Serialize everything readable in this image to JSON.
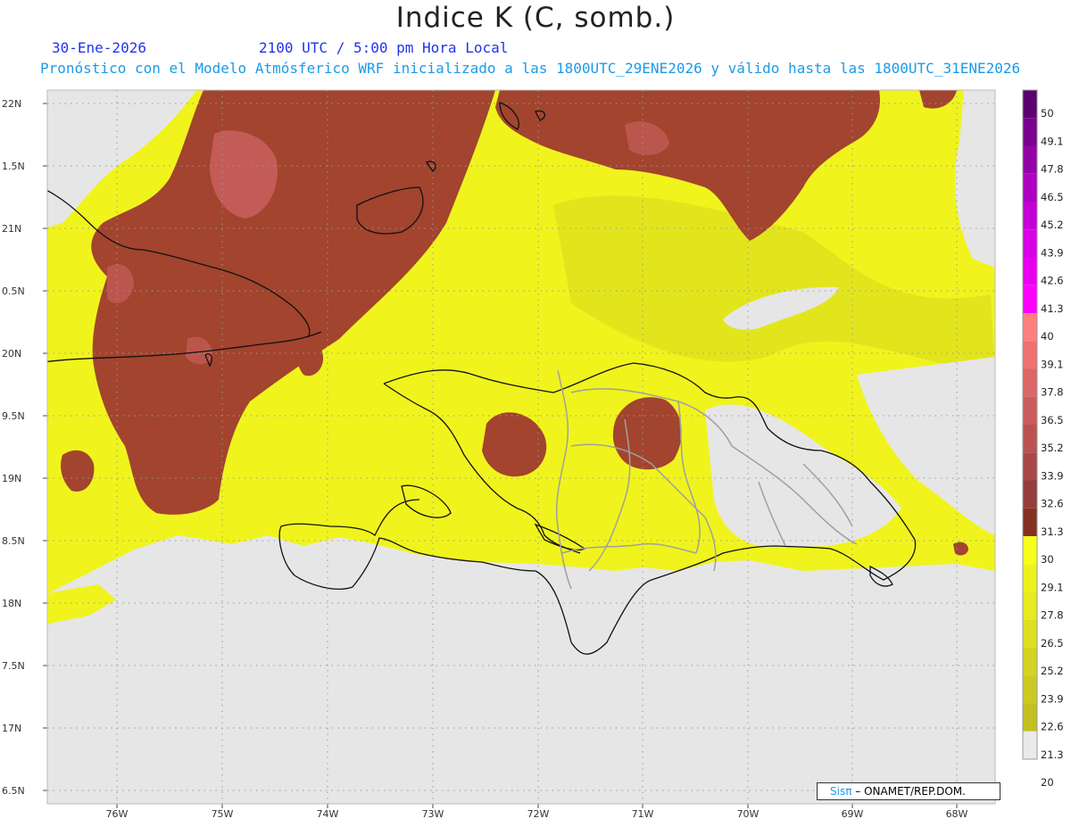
{
  "title": "Indice K (C, somb.)",
  "date": "30-Ene-2026",
  "time": "2100 UTC / 5:00 pm Hora Local",
  "info": "Pronóstico con el Modelo Atmósferico WRF inicializado a las 1800UTC_29ENE2026 y válido hasta las  1800UTC_31ENE2026",
  "lat_labels": [
    "22N",
    "1.5N",
    "21N",
    "0.5N",
    "20N",
    "9.5N",
    "19N",
    "8.5N",
    "18N",
    "7.5N",
    "17N",
    "6.5N"
  ],
  "lon_labels": [
    "76W",
    "75W",
    "74W",
    "73W",
    "72W",
    "71W",
    "70W",
    "69W",
    "68W"
  ],
  "colorbar": {
    "levels": [
      "50",
      "49.1",
      "47.8",
      "46.5",
      "45.2",
      "43.9",
      "42.6",
      "41.3",
      "40",
      "39.1",
      "37.8",
      "36.5",
      "35.2",
      "33.9",
      "32.6",
      "31.3",
      "30",
      "29.1",
      "27.8",
      "26.5",
      "25.2",
      "23.9",
      "22.6",
      "21.3",
      "20"
    ],
    "colors": [
      "#5c0070",
      "#7a0090",
      "#9400a8",
      "#ad00c0",
      "#c400d6",
      "#d800e4",
      "#ea00ee",
      "#ff00ff",
      "#ff8080",
      "#ee7070",
      "#dd6666",
      "#cc5c5c",
      "#bb5252",
      "#a84848",
      "#963c3c",
      "#843022",
      "#f5ff1a",
      "#eef21c",
      "#e6ea1e",
      "#dde020",
      "#d4d422",
      "#cbca22",
      "#c2c020",
      "#eaeaea"
    ]
  },
  "credit": {
    "brand": "Sisπ",
    "text": "– ONAMET/REP.DOM."
  },
  "colors": {
    "no_data": "#e6e6e6",
    "yellow": "#f0f41c",
    "brown": "#a2442e",
    "pink": "#cc6262"
  }
}
